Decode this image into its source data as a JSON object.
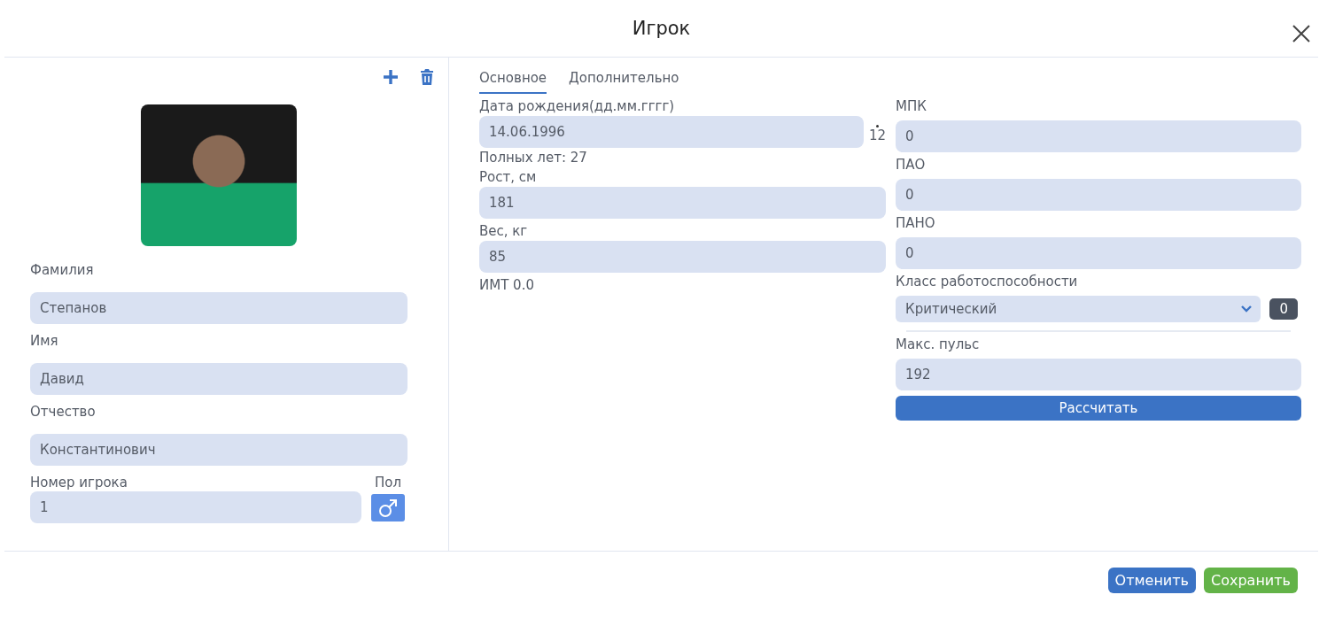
{
  "dialog": {
    "title": "Игрок"
  },
  "profile": {
    "surname": {
      "label": "Фамилия",
      "value": "Степанов"
    },
    "name": {
      "label": "Имя",
      "value": "Давид"
    },
    "patronymic": {
      "label": "Отчество",
      "value": "Константинович"
    },
    "number": {
      "label": "Номер игрока",
      "value": "1"
    },
    "gender": {
      "label": "Пол",
      "male": true
    }
  },
  "tabs": [
    {
      "label": "Основное",
      "selected": true
    },
    {
      "label": "Дополнительно",
      "selected": false
    }
  ],
  "main": {
    "birth_date": {
      "label": "Дата рождения(дд.мм.гггг)",
      "value": "14.06.1996",
      "side_text": "12"
    },
    "age": "Полных лет: 27",
    "height": {
      "label": "Рост, см",
      "value": "181"
    },
    "weight": {
      "label": "Вес, кг",
      "value": "85"
    },
    "bmi": "ИМТ 0.0",
    "metrics": [
      {
        "label": "МПК",
        "value": "0"
      },
      {
        "label": "ПАО",
        "value": "0"
      },
      {
        "label": "ПАНО",
        "value": "0"
      }
    ],
    "work_class": {
      "label": "Класс работоспособности",
      "value": "Критический",
      "badge": "0"
    },
    "max_pulse": {
      "label": "Макс. пульс",
      "value": "192"
    },
    "calculate": "Рассчитать"
  },
  "footer_buttons": [
    {
      "label": "Отменить",
      "kind": "cancel"
    },
    {
      "label": "Сохранить",
      "kind": "save"
    }
  ]
}
